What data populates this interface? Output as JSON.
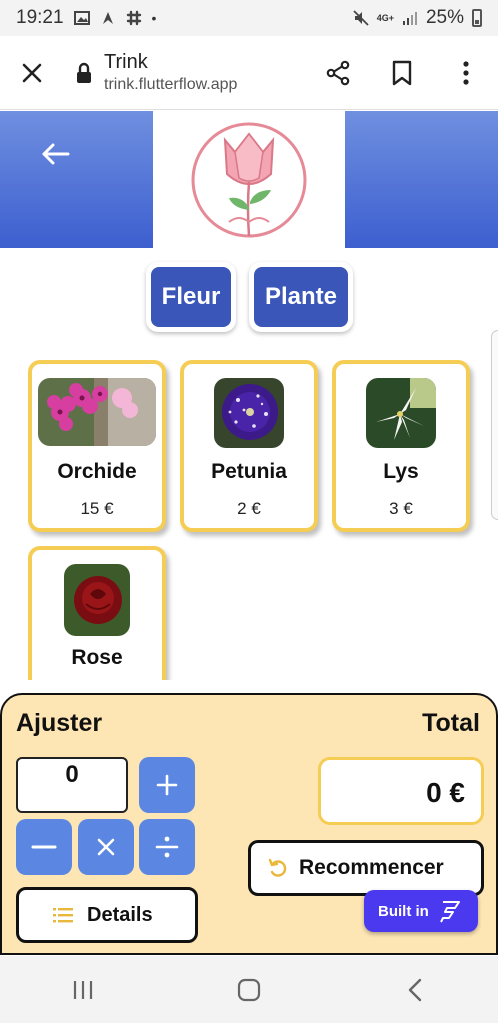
{
  "status_bar": {
    "time": "19:21",
    "battery": "25%",
    "network": "4G+"
  },
  "browser": {
    "title": "Trink",
    "url": "trink.flutterflow.app"
  },
  "categories": [
    {
      "label": "Fleur"
    },
    {
      "label": "Plante"
    }
  ],
  "products": [
    {
      "name": "Orchide",
      "price": "15 €",
      "image": "orchid-photo"
    },
    {
      "name": "Petunia",
      "price": "2 €",
      "image": "petunia-photo"
    },
    {
      "name": "Lys",
      "price": "3 €",
      "image": "lily-photo"
    },
    {
      "name": "Rose",
      "price": "",
      "image": "rose-photo"
    }
  ],
  "panel": {
    "adjust_label": "Ajuster",
    "total_label": "Total",
    "quantity": "0",
    "total_value": "0 €",
    "restart_label": "Recommencer",
    "details_label": "Details",
    "built_in_label": "Built in"
  },
  "colors": {
    "header_blue": "#3d5fcf",
    "button_blue": "#3a56b8",
    "card_border": "#f5cd55",
    "panel_bg": "#fde6b4",
    "op_blue": "#5b87e3",
    "badge_purple": "#4b39ef"
  }
}
